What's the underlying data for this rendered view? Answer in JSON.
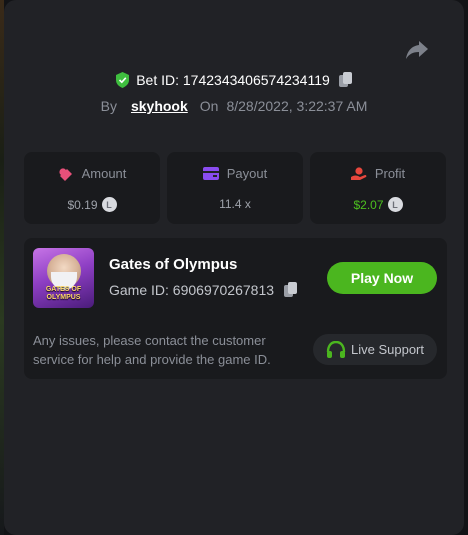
{
  "bet": {
    "id_label": "Bet ID: 1742343406574234119",
    "by_label": "By",
    "username": "skyhook",
    "on_label": "On",
    "timestamp": "8/28/2022, 3:22:37 AM"
  },
  "stats": [
    {
      "label": "Amount",
      "value": "$0.19",
      "icon": "coins-stack-icon",
      "color": "#e8507a"
    },
    {
      "label": "Payout",
      "value": "11.4 x",
      "icon": "wallet-icon",
      "color": "#8a4cf0"
    },
    {
      "label": "Profit",
      "value": "$2.07",
      "icon": "hand-coin-icon",
      "color": "#e8473d",
      "value_color": "#4cc01f"
    }
  ],
  "currency_icon": "L",
  "game": {
    "title": "Gates of Olympus",
    "id_label": "Game ID: 6906970267813",
    "thumb_text": "GATES OF OLYMPUS",
    "play_label": "Play Now"
  },
  "support": {
    "message": "Any issues, please contact the customer service for help and provide the game ID.",
    "button_label": "Live Support"
  },
  "colors": {
    "accent_green": "#4bb61f",
    "shield_green": "#3fbf3f"
  }
}
